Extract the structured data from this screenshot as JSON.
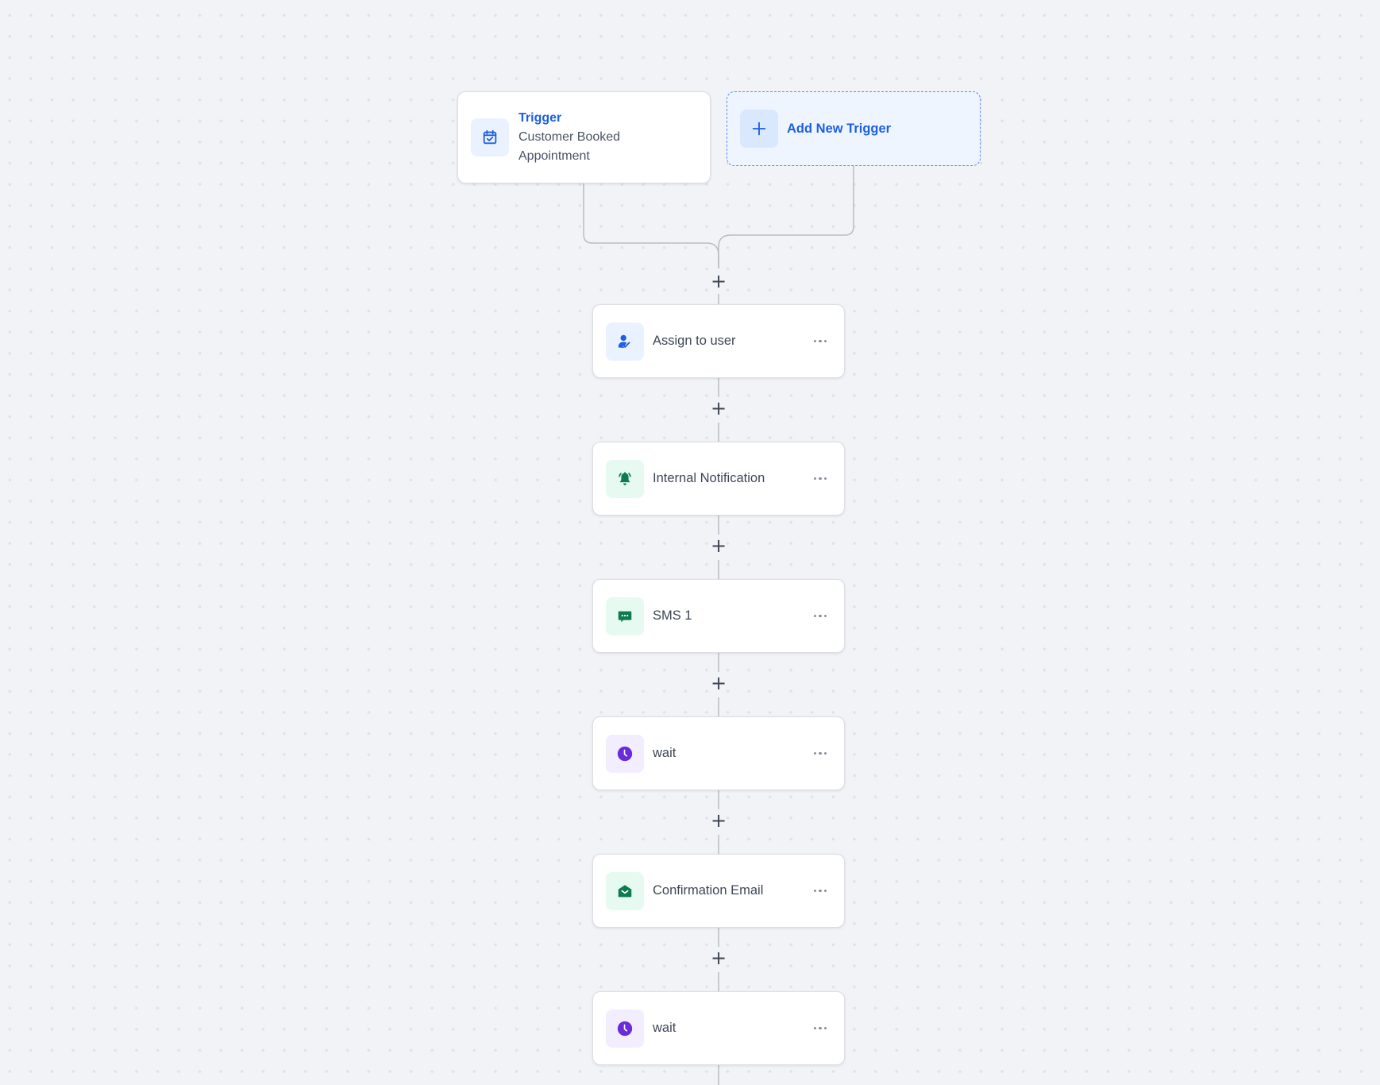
{
  "trigger": {
    "title": "Trigger",
    "subtitle": "Customer Booked Appointment",
    "icon": "calendar-check-icon"
  },
  "add_trigger": {
    "label": "Add New Trigger",
    "icon": "plus-icon"
  },
  "add_step_symbol": "+",
  "actions": [
    {
      "label": "Assign to user",
      "icon": "user-check-icon",
      "color": "#1d5fe0",
      "bg": "blue"
    },
    {
      "label": "Internal Notification",
      "icon": "bell-ringing-icon",
      "color": "#0d7a4f",
      "bg": "green"
    },
    {
      "label": "SMS 1",
      "icon": "chat-message-icon",
      "color": "#0d7a4f",
      "bg": "green"
    },
    {
      "label": "wait",
      "icon": "clock-icon",
      "color": "#6a2bd9",
      "bg": "purple"
    },
    {
      "label": "Confirmation Email",
      "icon": "envelope-open-icon",
      "color": "#0d7a4f",
      "bg": "green"
    },
    {
      "label": "wait",
      "icon": "clock-icon",
      "color": "#6a2bd9",
      "bg": "purple"
    }
  ],
  "colors": {
    "accent": "#1d5fe0",
    "canvas_bg": "#f2f3f7",
    "connector": "#b9bcc4"
  }
}
